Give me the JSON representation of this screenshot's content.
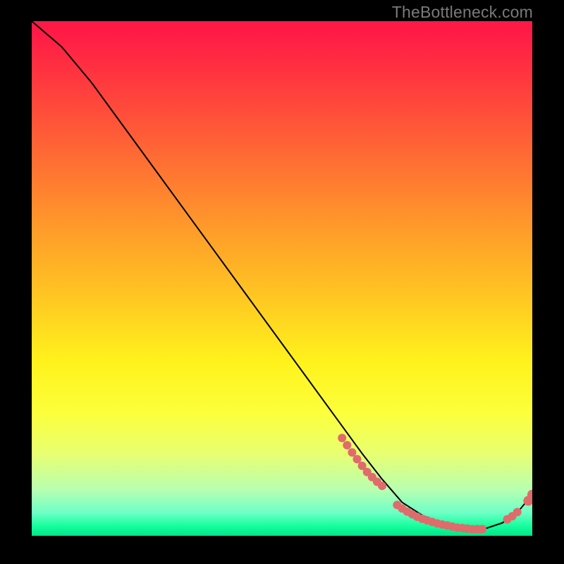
{
  "watermark": "TheBottleneck.com",
  "chart_data": {
    "type": "line",
    "title": "",
    "xlabel": "",
    "ylabel": "",
    "xlim": [
      0,
      100
    ],
    "ylim": [
      0,
      100
    ],
    "grid": false,
    "legend": false,
    "series": [
      {
        "name": "curve",
        "x": [
          0,
          6,
          12,
          18,
          24,
          30,
          36,
          42,
          48,
          54,
          60,
          66,
          70,
          74,
          78,
          82,
          86,
          90,
          94,
          97,
          100
        ],
        "y": [
          100,
          95,
          88,
          80,
          72,
          64,
          56,
          48,
          40,
          32,
          24,
          16,
          11,
          6.5,
          4,
          2.2,
          1.3,
          1.2,
          2.5,
          4.5,
          8
        ],
        "stroke": "#000000",
        "stroke_width": 2
      }
    ],
    "markers": [
      {
        "name": "dashed-cluster-left",
        "x": [
          62,
          63,
          64,
          65,
          66,
          67,
          68,
          69,
          70
        ],
        "y": [
          19,
          17.6,
          16.2,
          14.9,
          13.6,
          12.4,
          11.4,
          10.5,
          9.7
        ],
        "color": "#e06b6b",
        "size": 6
      },
      {
        "name": "flat-cluster",
        "x": [
          73,
          74,
          75,
          76,
          77,
          78,
          79,
          80,
          81,
          82,
          83,
          84,
          85,
          86,
          87,
          88,
          89,
          90
        ],
        "y": [
          6.0,
          5.3,
          4.7,
          4.2,
          3.7,
          3.3,
          3.0,
          2.7,
          2.4,
          2.2,
          2.0,
          1.8,
          1.6,
          1.5,
          1.4,
          1.3,
          1.3,
          1.3
        ],
        "color": "#e06b6b",
        "size": 6
      },
      {
        "name": "rise-cluster",
        "x": [
          95,
          96,
          97
        ],
        "y": [
          3.2,
          3.8,
          4.6
        ],
        "color": "#e06b6b",
        "size": 6
      },
      {
        "name": "end-markers",
        "x": [
          99.2,
          100
        ],
        "y": [
          6.8,
          8.0
        ],
        "color": "#e06b6b",
        "size": 7
      }
    ]
  }
}
